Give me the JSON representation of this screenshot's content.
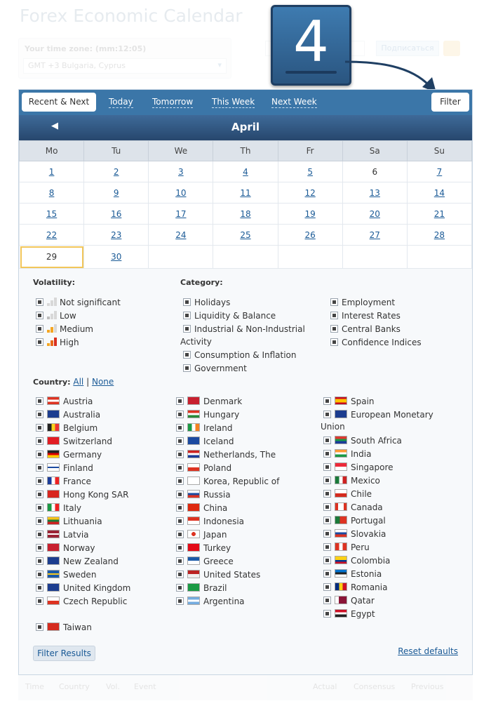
{
  "background": {
    "title": "Forex Economic Calendar",
    "timezone_label": "Your time zone: (mm:12:05)",
    "timezone_value": "GMT +3 Bulgaria, Cyprus",
    "btn_label": "Подписаться",
    "footer_cols": [
      "Time",
      "Country",
      "Vol.",
      "Event",
      "Actual",
      "Consensus",
      "Previous"
    ]
  },
  "step_badge": "4",
  "tabs": {
    "recent_next": "Recent & Next",
    "today": "Today",
    "tomorrow": "Tomorrow",
    "this_week": "This Week",
    "next_week": "Next Week",
    "filter": "Filter"
  },
  "calendar": {
    "month": "April",
    "prev_icon": "◀",
    "weekdays": [
      "Mo",
      "Tu",
      "We",
      "Th",
      "Fr",
      "Sa",
      "Su"
    ],
    "weeks": [
      [
        "1",
        "2",
        "3",
        "4",
        "5",
        "6",
        "7"
      ],
      [
        "8",
        "9",
        "10",
        "11",
        "12",
        "13",
        "14"
      ],
      [
        "15",
        "16",
        "17",
        "18",
        "19",
        "20",
        "21"
      ],
      [
        "22",
        "23",
        "24",
        "25",
        "26",
        "27",
        "28"
      ],
      [
        "29",
        "30",
        "",
        "",
        "",
        "",
        ""
      ]
    ],
    "non_link_days": [
      "6",
      "29"
    ],
    "today": "29"
  },
  "filters": {
    "volatility_label": "Volatility:",
    "volatility": [
      "Not significant",
      "Low",
      "Medium",
      "High"
    ],
    "category_label": "Category:",
    "categories_col1": [
      "Holidays",
      "Liquidity & Balance",
      "Industrial & Non-Industrial",
      "Consumption & Inflation",
      "Government"
    ],
    "category_wrap": "Activity",
    "categories_col2": [
      "Employment",
      "Interest Rates",
      "Central Banks",
      "Confidence Indices"
    ],
    "country_label": "Country:",
    "country_all": "All",
    "country_sep": "|",
    "country_none": "None",
    "countries_col1": [
      "Austria",
      "Australia",
      "Belgium",
      "Switzerland",
      "Germany",
      "Finland",
      "France",
      "Hong Kong SAR",
      "Italy",
      "Lithuania",
      "Latvia",
      "Norway",
      "New Zealand",
      "Sweden",
      "United Kingdom",
      "Czech Republic"
    ],
    "countries_col1_extra": "Taiwan",
    "countries_col2": [
      "Denmark",
      "Hungary",
      "Ireland",
      "Iceland",
      "Netherlands, The",
      "Poland",
      "Korea, Republic of",
      "Russia",
      "China",
      "Indonesia",
      "Japan",
      "Turkey",
      "Greece",
      "United States",
      "Brazil",
      "Argentina"
    ],
    "countries_col3_first": [
      "Spain",
      "European Monetary"
    ],
    "countries_col3_wrap": "Union",
    "countries_col3": [
      "South Africa",
      "India",
      "Singapore",
      "Mexico",
      "Chile",
      "Canada",
      "Portugal",
      "Slovakia",
      "Peru",
      "Colombia",
      "Estonia",
      "Romania",
      "Qatar",
      "Egypt"
    ],
    "filter_results": "Filter Results",
    "reset_defaults": "Reset defaults"
  },
  "colors": {
    "tab_bar": "#3b76a8",
    "month_bar": "#2f5884",
    "link": "#1a5a96",
    "today_outline": "#f2c65a"
  }
}
